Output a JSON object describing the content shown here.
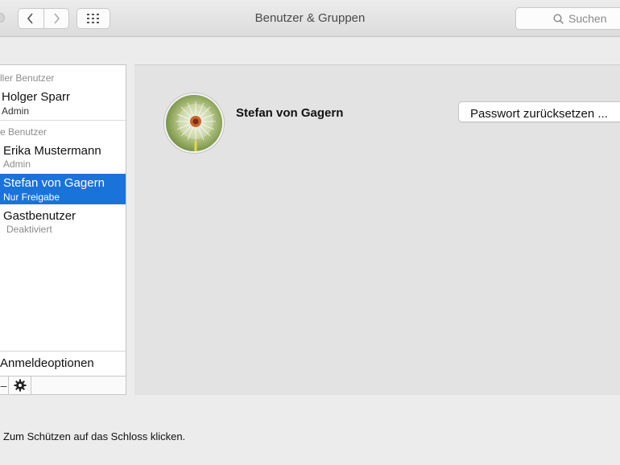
{
  "window": {
    "title": "Benutzer & Gruppen"
  },
  "toolbar": {
    "search_placeholder": "Suchen",
    "back_icon": "chevron-left-icon",
    "forward_icon": "chevron-right-icon",
    "grid_icon": "grid-icon"
  },
  "sidebar": {
    "current_header": "ller Benutzer",
    "other_header": "e Benutzer",
    "users": [
      {
        "name": "Holger Sparr",
        "role": "Admin"
      },
      {
        "name": "Erika Mustermann",
        "role": "Admin"
      },
      {
        "name": "Stefan von Gagern",
        "role": "Nur Freigabe"
      },
      {
        "name": "Gastbenutzer",
        "role": "Deaktiviert"
      }
    ],
    "login_options": "Anmeldeoptionen",
    "remove_label": "–"
  },
  "detail": {
    "user_name": "Stefan von Gagern",
    "reset_password": "Passwort zurücksetzen ..."
  },
  "footer": {
    "lock_text": "Zum Schützen auf das Schloss klicken."
  },
  "colors": {
    "selection": "#1a73d9"
  }
}
